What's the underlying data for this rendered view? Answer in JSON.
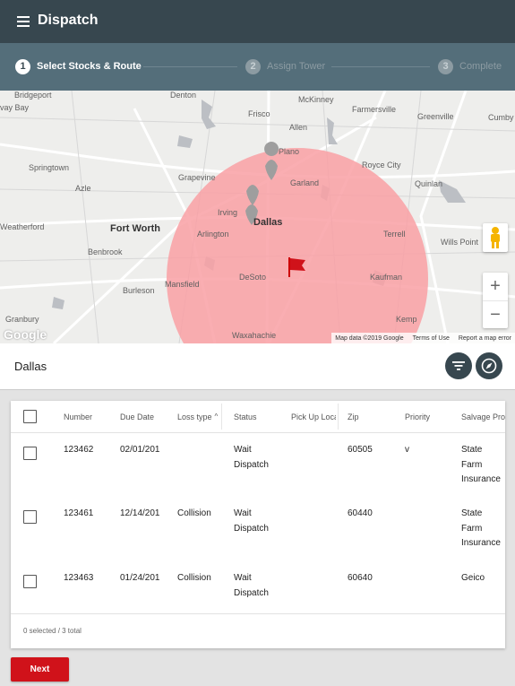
{
  "app": {
    "title": "Dispatch"
  },
  "stepper": {
    "steps": [
      {
        "number": "1",
        "label": "Select Stocks & Route"
      },
      {
        "number": "2",
        "label": "Assign Tower"
      },
      {
        "number": "3",
        "label": "Complete"
      }
    ]
  },
  "map": {
    "places": [
      "Bridgeport",
      "vay Bay",
      "Denton",
      "McKinney",
      "Frisco",
      "Farmersville",
      "Greenville",
      "Allen",
      "Plano",
      "Royce City",
      "Springtown",
      "Azle",
      "Grapevine",
      "Garland",
      "Quinlan",
      "Irving",
      "Dallas",
      "Weatherford",
      "Fort Worth",
      "Arlington",
      "Terrell",
      "Wills Point",
      "Benbrook",
      "Mansfield",
      "DeSoto",
      "Kaufman",
      "Burleson",
      "Granbury",
      "Kemp",
      "Waxahachie",
      "Cumby"
    ],
    "google_logo": "Google",
    "attribution": {
      "data": "Map data ©2019 Google",
      "terms": "Terms of Use",
      "report": "Report a map error"
    },
    "zoom_in": "+",
    "zoom_out": "−"
  },
  "location": {
    "name": "Dallas"
  },
  "table": {
    "columns": [
      "Number",
      "Due Date",
      "Loss type",
      "Status",
      "Pick Up Location",
      "Zip",
      "Priority",
      "Salvage Provider"
    ],
    "sort_indicator": "^",
    "rows": [
      {
        "number": "123462",
        "due_date": "02/01/201",
        "loss_type": "",
        "status": [
          "Wait",
          "Dispatch"
        ],
        "zip": "60505",
        "priority": "v",
        "salvage": [
          "State",
          "Farm",
          "Insurance"
        ]
      },
      {
        "number": "123461",
        "due_date": "12/14/201",
        "loss_type": "Collision",
        "status": [
          "Wait",
          "Dispatch"
        ],
        "zip": "60440",
        "priority": "",
        "salvage": [
          "State",
          "Farm",
          "Insurance"
        ]
      },
      {
        "number": "123463",
        "due_date": "01/24/201",
        "loss_type": "Collision",
        "status": [
          "Wait",
          "Dispatch"
        ],
        "zip": "60640",
        "priority": "",
        "salvage": [
          "Geico"
        ]
      }
    ],
    "footer": "0 selected / 3 total"
  },
  "actions": {
    "next": "Next"
  },
  "colors": {
    "appbar": "#37474f",
    "stepper": "#546e7a",
    "radius": "#f9a0a5",
    "flag": "#d0121a",
    "next_button": "#d0121a"
  }
}
